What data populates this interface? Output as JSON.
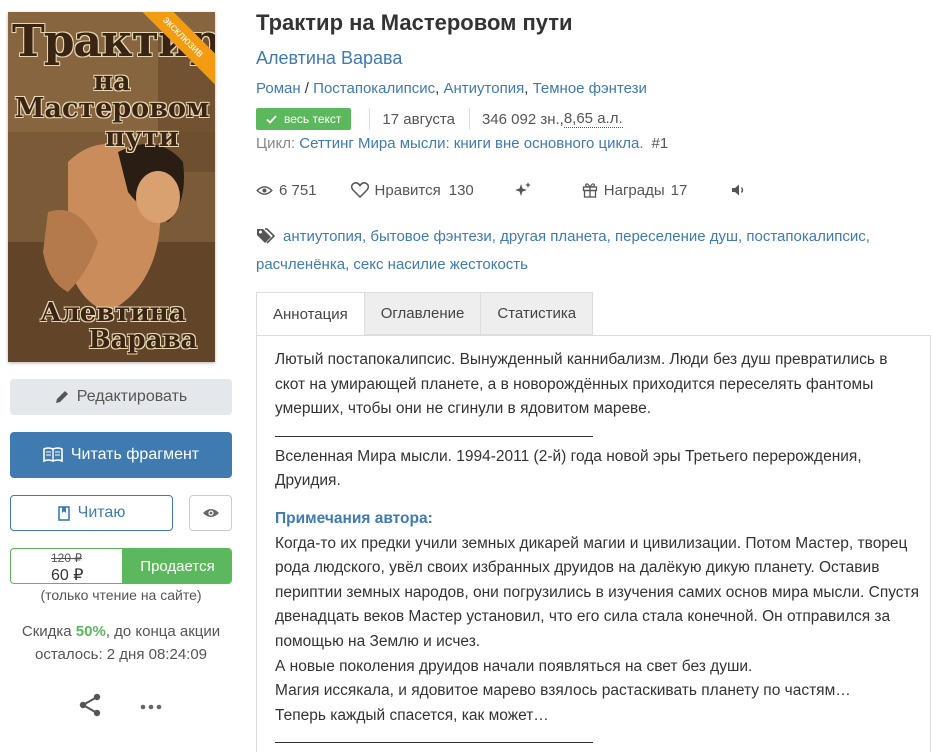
{
  "cover": {
    "ribbon": "эксклюзив",
    "title_l1": "Трактир",
    "title_l2": "на Мастеровом",
    "title_l3": "пути",
    "author_l1": "Алевтина",
    "author_l2": "Варава"
  },
  "left": {
    "edit_label": "Редактировать",
    "read_fragment_label": "Читать фрагмент",
    "reading_label": "Читаю",
    "price_old": "120 ₽",
    "price_new": "60 ₽",
    "sell_label": "Продается",
    "only_site": "(только чтение на сайте)",
    "discount_prefix": "Скидка ",
    "discount_pct": "50%",
    "discount_suffix": ", до конца акции",
    "discount_remaining": "осталось: 2 дня 08:24:09"
  },
  "book": {
    "title": "Трактир на Мастеровом пути",
    "author": "Алевтина Варава",
    "genre_1": "Роман",
    "genre_sep": " / ",
    "genre_2": "Постапокалипсис",
    "genre_3": "Антиутопия",
    "genre_4": "Темное фэнтези",
    "full_text_badge": "весь текст",
    "date": "17 августа",
    "size_chars": "346 092 зн., ",
    "size_al": "8,65 а.л.",
    "cycle_label": "Цикл: ",
    "cycle_name": "Сеттинг Мира мысли: книги вне основного цикла.",
    "cycle_num": "#1"
  },
  "stats": {
    "views": "6 751",
    "likes_label": "Нравится",
    "likes": "130",
    "awards_label": "Награды",
    "awards": "17"
  },
  "tags": [
    "антиутопия",
    "бытовое фэнтези",
    "другая планета",
    "переселение душ",
    "постапокалипсис",
    "расчленёнка",
    "секс насилие жестокость"
  ],
  "tabs": {
    "annotation": "Аннотация",
    "contents": "Оглавление",
    "statistics": "Статистика"
  },
  "annotation": {
    "p1": "Лютый постапокалипсис. Вынужденный каннибализм. Люди без душ превратились в скот на умирающей планете, а в новорождённых приходится переселять фантомы умерших, чтобы они не сгинули в ядовитом мареве.",
    "p2": "Вселенная Мира мысли. 1994-2011 (2-й) года новой эры Третьего перерождения, Друидия.",
    "notes_heading": "Примечания автора:",
    "p3": "Когда-то их предки учили земных дикарей магии и цивилизации. Потом Мастер, творец рода людского, увёл своих избранных друидов на далёкую дикую планету. Оставив периптии земных народов, они погрузились в изучения самих основ мира мысли. Спустя двенадцать веков Мастер установил, что его сила стала конечной. Он отправился за помощью на Землю и исчез.",
    "p4": "А новые поколения друидов начали появляться на свет без души.",
    "p5": "Магия иссякала, и ядовитое марево взялось растаскивать планету по частям…",
    "p6": "Теперь каждый спасется, как может…"
  }
}
